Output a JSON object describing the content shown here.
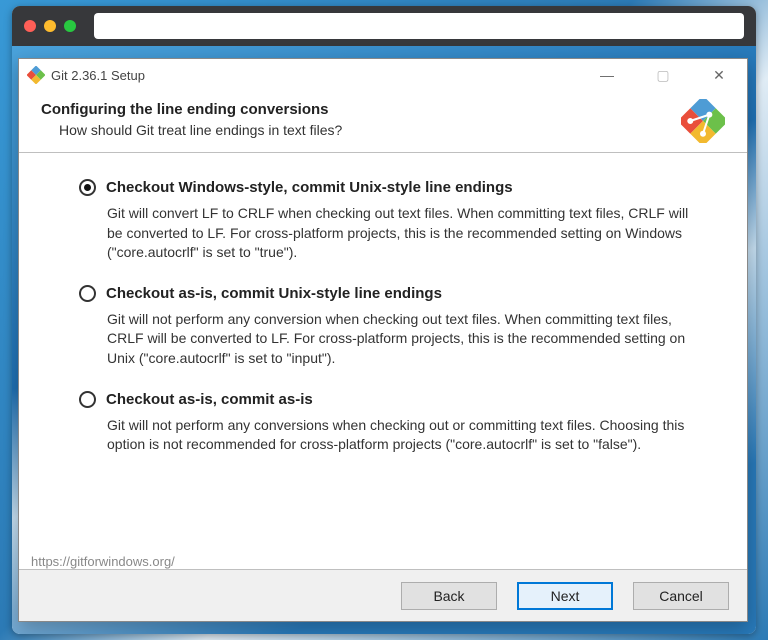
{
  "chrome": {
    "url": ""
  },
  "window": {
    "title": "Git 2.36.1 Setup"
  },
  "header": {
    "title": "Configuring the line ending conversions",
    "subtitle": "How should Git treat line endings in text files?"
  },
  "options": [
    {
      "label": "Checkout Windows-style, commit Unix-style line endings",
      "description": "Git will convert LF to CRLF when checking out text files. When committing text files, CRLF will be converted to LF. For cross-platform projects, this is the recommended setting on Windows (\"core.autocrlf\" is set to \"true\").",
      "selected": true
    },
    {
      "label": "Checkout as-is, commit Unix-style line endings",
      "description": "Git will not perform any conversion when checking out text files. When committing text files, CRLF will be converted to LF. For cross-platform projects, this is the recommended setting on Unix (\"core.autocrlf\" is set to \"input\").",
      "selected": false
    },
    {
      "label": "Checkout as-is, commit as-is",
      "description": "Git will not perform any conversions when checking out or committing text files. Choosing this option is not recommended for cross-platform projects (\"core.autocrlf\" is set to \"false\").",
      "selected": false
    }
  ],
  "footer_link": "https://gitforwindows.org/",
  "buttons": {
    "back": "Back",
    "next": "Next",
    "cancel": "Cancel"
  }
}
